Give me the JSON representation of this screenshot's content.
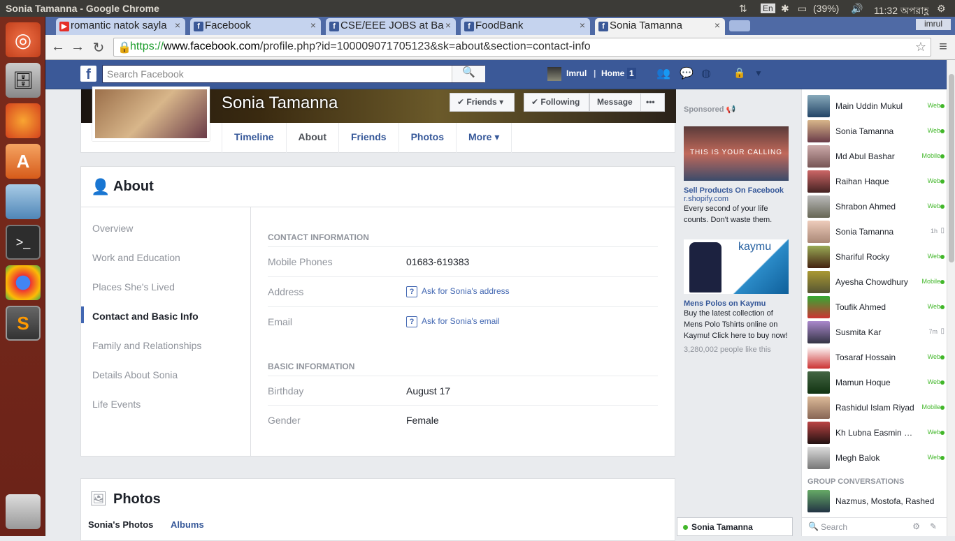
{
  "system": {
    "window_title": "Sonia Tamanna - Google Chrome",
    "lang": "En",
    "battery": "(39%)",
    "clock": "11:32 অপরাহ্ণ",
    "user": "imrul"
  },
  "tabs": [
    {
      "label": "romantic natok sayla",
      "icon": "youtube-icon"
    },
    {
      "label": "Facebook",
      "icon": "facebook-icon"
    },
    {
      "label": "CSE/EEE JOBS at Ba",
      "icon": "facebook-icon"
    },
    {
      "label": "FoodBank",
      "icon": "facebook-icon"
    },
    {
      "label": "Sonia Tamanna",
      "icon": "facebook-icon",
      "active": true
    }
  ],
  "url": {
    "scheme": "https://",
    "domain": "www.facebook.com",
    "path": "/profile.php?id=100009071705123&sk=about&section=contact-info"
  },
  "fb": {
    "search_placeholder": "Search Facebook",
    "user": "Imrul",
    "home": "Home",
    "home_count": "1"
  },
  "profile": {
    "name": "Sonia Tamanna",
    "friends_btn": "Friends",
    "following_btn": "Following",
    "message_btn": "Message",
    "more_btn": "•••",
    "tabs": [
      "Timeline",
      "About",
      "Friends",
      "Photos",
      "More"
    ]
  },
  "about": {
    "title": "About",
    "nav": [
      "Overview",
      "Work and Education",
      "Places She's Lived",
      "Contact and Basic Info",
      "Family and Relationships",
      "Details About Sonia",
      "Life Events"
    ],
    "contact_header": "CONTACT INFORMATION",
    "mobile_label": "Mobile Phones",
    "mobile_value": "01683-619383",
    "address_label": "Address",
    "address_link": "Ask for Sonia's address",
    "email_label": "Email",
    "email_link": "Ask for Sonia's email",
    "basic_header": "BASIC INFORMATION",
    "birthday_label": "Birthday",
    "birthday_value": "August 17",
    "gender_label": "Gender",
    "gender_value": "Female"
  },
  "photos": {
    "title": "Photos",
    "tab1": "Sonia's Photos",
    "tab2": "Albums"
  },
  "ads": {
    "sponsored": "Sponsored",
    "ad1_banner": "THIS IS YOUR CALLING",
    "ad1_title": "Sell Products On Facebook",
    "ad1_site": "r.shopify.com",
    "ad1_text": "Every second of your life counts. Don't waste them.",
    "ad2_brand": "kaymu",
    "ad2_title": "Mens Polos on Kaymu",
    "ad2_text": "Buy the latest collection of Mens Polo Tshirts online on Kaymu! Click here to buy now!",
    "ad2_likes": "3,280,002 people like this"
  },
  "chat": {
    "contacts": [
      {
        "name": "Main Uddin Mukul",
        "status": "Web"
      },
      {
        "name": "Sonia Tamanna",
        "status": "Web"
      },
      {
        "name": "Md Abul Bashar",
        "status": "Mobile"
      },
      {
        "name": "Raihan Haque",
        "status": "Web"
      },
      {
        "name": "Shrabon Ahmed",
        "status": "Web"
      },
      {
        "name": "Sonia Tamanna",
        "status": "1h"
      },
      {
        "name": "Shariful Rocky",
        "status": "Web"
      },
      {
        "name": "Ayesha Chowdhury",
        "status": "Mobile"
      },
      {
        "name": "Toufik Ahmed",
        "status": "Web"
      },
      {
        "name": "Susmita Kar",
        "status": "7m"
      },
      {
        "name": "Tosaraf Hossain",
        "status": "Web"
      },
      {
        "name": "Mamun Hoque",
        "status": "Web"
      },
      {
        "name": "Rashidul Islam Riyad",
        "status": "Mobile"
      },
      {
        "name": "Kh Lubna Easmin Keya",
        "status": "Web"
      },
      {
        "name": "Megh Balok",
        "status": "Web"
      }
    ],
    "group_header": "GROUP CONVERSATIONS",
    "group1": "Nazmus, Mostofa, Rashed",
    "search": "Search",
    "open_chat": "Sonia Tamanna"
  }
}
